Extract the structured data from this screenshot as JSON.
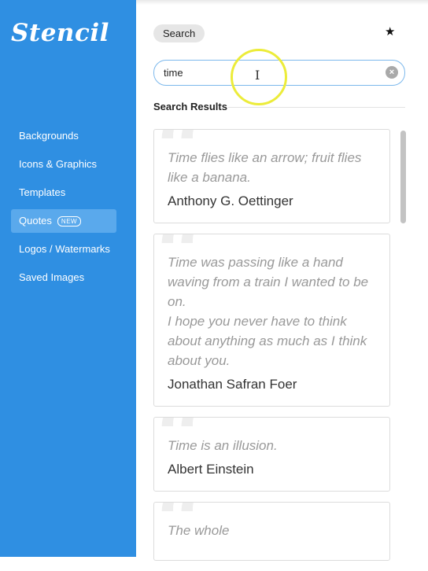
{
  "app": {
    "logo": "Stencil"
  },
  "sidebar": {
    "items": [
      {
        "label": "Backgrounds"
      },
      {
        "label": "Icons & Graphics"
      },
      {
        "label": "Templates"
      },
      {
        "label": "Quotes",
        "badge": "NEW",
        "active": true
      },
      {
        "label": "Logos / Watermarks"
      },
      {
        "label": "Saved Images"
      }
    ]
  },
  "header": {
    "tab_label": "Search",
    "star_icon": "star-icon"
  },
  "search": {
    "value": "time",
    "clear_icon": "clear-icon"
  },
  "results": {
    "heading": "Search Results",
    "items": [
      {
        "quote": "Time flies like an arrow; fruit flies like a banana.",
        "author": "Anthony G. Oettinger"
      },
      {
        "quote": "Time was passing like a hand waving from a train I wanted to be on.\nI hope you never have to think about anything as much as I think about you.",
        "author": "Jonathan Safran Foer"
      },
      {
        "quote": "Time is an illusion.",
        "author": "Albert Einstein"
      },
      {
        "quote": "The whole",
        "author": ""
      }
    ]
  },
  "colors": {
    "sidebar": "#2f8fe2",
    "active_item": "#5aa9ec",
    "input_border": "#7cb8ec",
    "cursor_highlight": "#ecec3a"
  }
}
